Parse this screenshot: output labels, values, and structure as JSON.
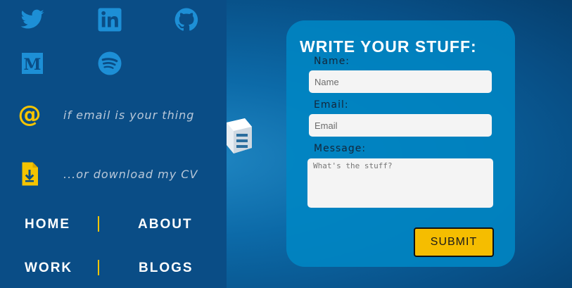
{
  "sidebar": {
    "social": [
      {
        "icon": "twitter-icon"
      },
      {
        "icon": "linkedin-icon"
      },
      {
        "icon": "github-icon"
      },
      {
        "icon": "medium-icon"
      },
      {
        "icon": "spotify-icon"
      }
    ],
    "email_label": "if email is your thing",
    "cv_label": "...or download my CV",
    "nav": {
      "home": "HOME",
      "about": "ABOUT",
      "work": "WORK",
      "blogs": "BLOGS"
    }
  },
  "form": {
    "title": "WRITE YOUR STUFF:",
    "name_label": "Name:",
    "name_placeholder": "Name",
    "email_label": "Email:",
    "email_placeholder": "Email",
    "message_label": "Message:",
    "message_placeholder": "What's the stuff?",
    "submit_label": "SUBMIT"
  },
  "colors": {
    "sidebar_bg": "#0a4d86",
    "accent_yellow": "#f5c400",
    "card_bg": "#0086c4",
    "icon_blue": "#1d8fd6"
  }
}
